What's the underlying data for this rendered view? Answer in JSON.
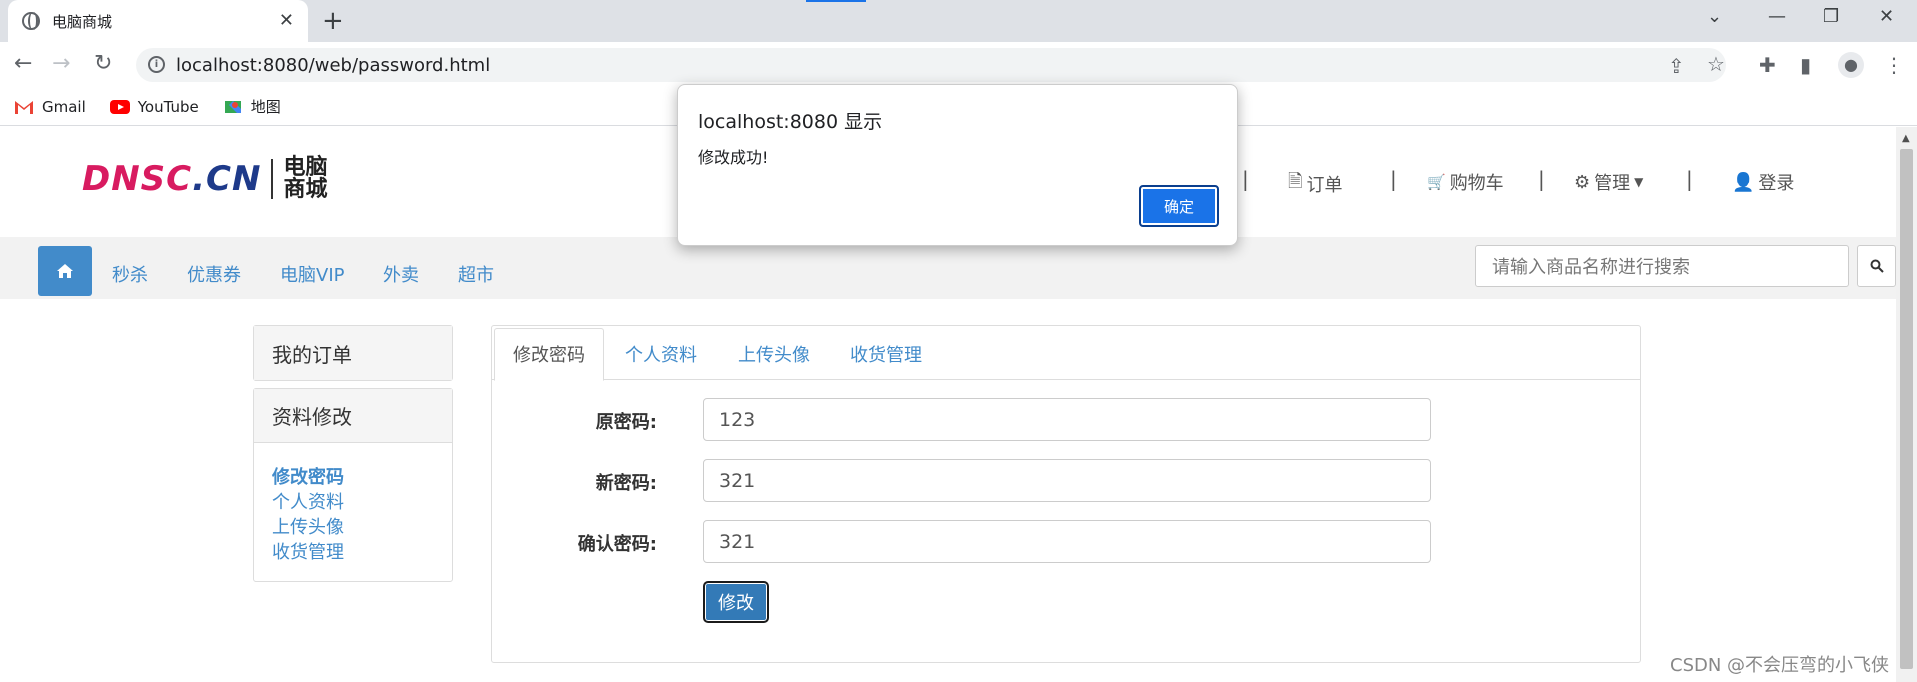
{
  "browser": {
    "tab_title": "电脑商城",
    "tab_close": "✕",
    "new_tab": "+",
    "url": "localhost:8080/web/password.html",
    "bookmarks": [
      {
        "label": "Gmail",
        "icon": "gmail-icon"
      },
      {
        "label": "YouTube",
        "icon": "youtube-icon"
      },
      {
        "label": "地图",
        "icon": "maps-icon"
      }
    ]
  },
  "header": {
    "logo_text_part1": "DNSC",
    "logo_text_part2": ".CN",
    "logo_cn_line1": "电脑",
    "logo_cn_line2": "商城",
    "nav": {
      "orders": "订单",
      "cart": "购物车",
      "manage": "管理",
      "login": "登录"
    },
    "pipe": "|"
  },
  "navbar": {
    "links": [
      "秒杀",
      "优惠券",
      "电脑VIP",
      "外卖",
      "超市"
    ],
    "search_placeholder": "请输入商品名称进行搜索"
  },
  "sidebar": {
    "my_orders": "我的订单",
    "edit_profile": "资料修改",
    "links": [
      "修改密码",
      "个人资料",
      "上传头像",
      "收货管理"
    ]
  },
  "main": {
    "tabs": [
      "修改密码",
      "个人资料",
      "上传头像",
      "收货管理"
    ],
    "fields": [
      {
        "label": "原密码:",
        "value": "123"
      },
      {
        "label": "新密码:",
        "value": "321"
      },
      {
        "label": "确认密码:",
        "value": "321"
      }
    ],
    "submit_label": "修改"
  },
  "dialog": {
    "title": "localhost:8080 显示",
    "message": "修改成功!",
    "ok_label": "确定"
  },
  "watermark": "CSDN @不会压弯的小飞侠",
  "colors": {
    "accent": "#428bca",
    "dialog_button": "#1a73e8",
    "logo_pink": "#d81b60",
    "logo_navy": "#1e3a8a"
  }
}
